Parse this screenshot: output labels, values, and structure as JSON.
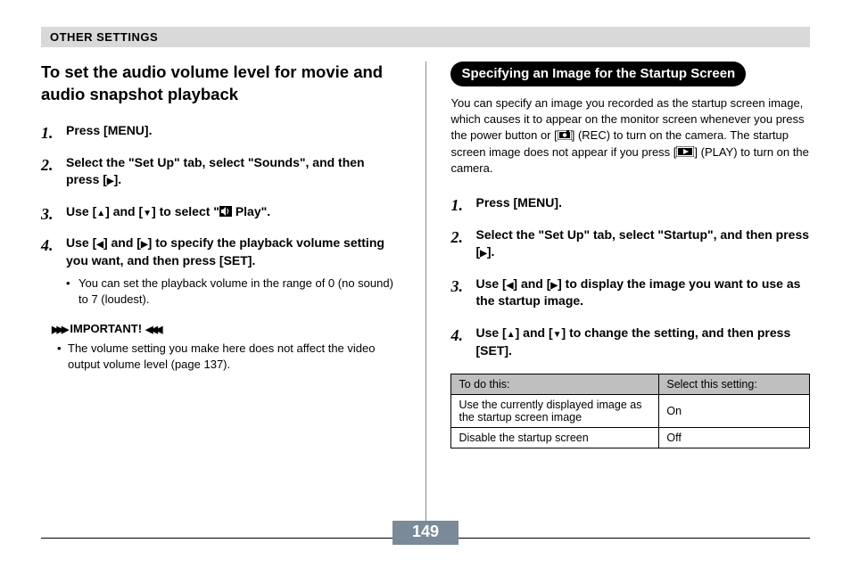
{
  "header": {
    "section": "OTHER SETTINGS"
  },
  "left": {
    "title": "To set the audio volume level for movie and audio snapshot playback",
    "steps": [
      {
        "text": "Press [MENU]."
      },
      {
        "text_parts": [
          "Select the \"Set Up\" tab, select \"Sounds\", and then press [",
          "RIGHT",
          "]."
        ]
      },
      {
        "text_parts": [
          "Use [",
          "UP",
          "] and [",
          "DOWN",
          "] to select \"",
          "SPEAKER",
          " Play\"."
        ]
      },
      {
        "text_parts": [
          "Use [",
          "LEFT",
          "] and [",
          "RIGHT",
          "] to specify the playback volume setting you want, and then press [SET]."
        ],
        "sub": [
          "You can set the playback volume in the range of 0 (no sound) to 7 (loudest)."
        ]
      }
    ],
    "important": {
      "label": "IMPORTANT!",
      "text": "The volume setting you make here does not affect the video output volume level (page 137)."
    }
  },
  "right": {
    "pill": "Specifying an Image for the Startup Screen",
    "intro_parts": [
      "You can specify an image you recorded as the startup screen image, which causes it to appear on the monitor screen whenever you press the power button or [",
      "CAMERA",
      "] (REC) to turn on the camera. The startup screen image does not appear if you press [",
      "PLAY",
      "] (PLAY) to turn on the camera."
    ],
    "steps": [
      {
        "text": "Press [MENU]."
      },
      {
        "text_parts": [
          "Select the \"Set Up\" tab, select \"Startup\", and then press [",
          "RIGHT",
          "]."
        ]
      },
      {
        "text_parts": [
          "Use [",
          "LEFT",
          "] and [",
          "RIGHT",
          "] to display the image you want to use as the startup image."
        ]
      },
      {
        "text_parts": [
          "Use [",
          "UP",
          "] and [",
          "DOWN",
          "] to change the setting, and then press [SET]."
        ]
      }
    ],
    "table": {
      "headers": [
        "To do this:",
        "Select this setting:"
      ],
      "rows": [
        [
          "Use the currently displayed image as the startup screen image",
          "On"
        ],
        [
          "Disable the startup screen",
          "Off"
        ]
      ]
    }
  },
  "page_number": "149"
}
